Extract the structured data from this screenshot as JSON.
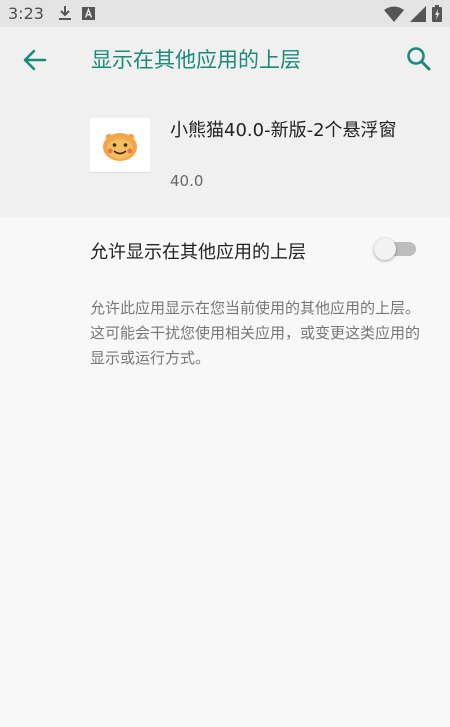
{
  "status_bar": {
    "time": "3:23",
    "icons": [
      "download-icon",
      "a-notification-icon",
      "wifi-icon",
      "cell-signal-icon",
      "battery-icon"
    ]
  },
  "app_bar": {
    "title": "显示在其他应用的上层",
    "back_icon": "arrow-left-icon",
    "search_icon": "search-icon",
    "accent_color": "#1b8a7a"
  },
  "app": {
    "name": "小熊猫40.0-新版-2个悬浮窗",
    "version": "40.0",
    "icon": "smiley-bear-app-icon"
  },
  "setting": {
    "label": "允许显示在其他应用的上层",
    "enabled": false,
    "description": "允许此应用显示在您当前使用的其他应用的上层。这可能会干扰您使用相关应用，或变更这类应用的显示或运行方式。"
  }
}
